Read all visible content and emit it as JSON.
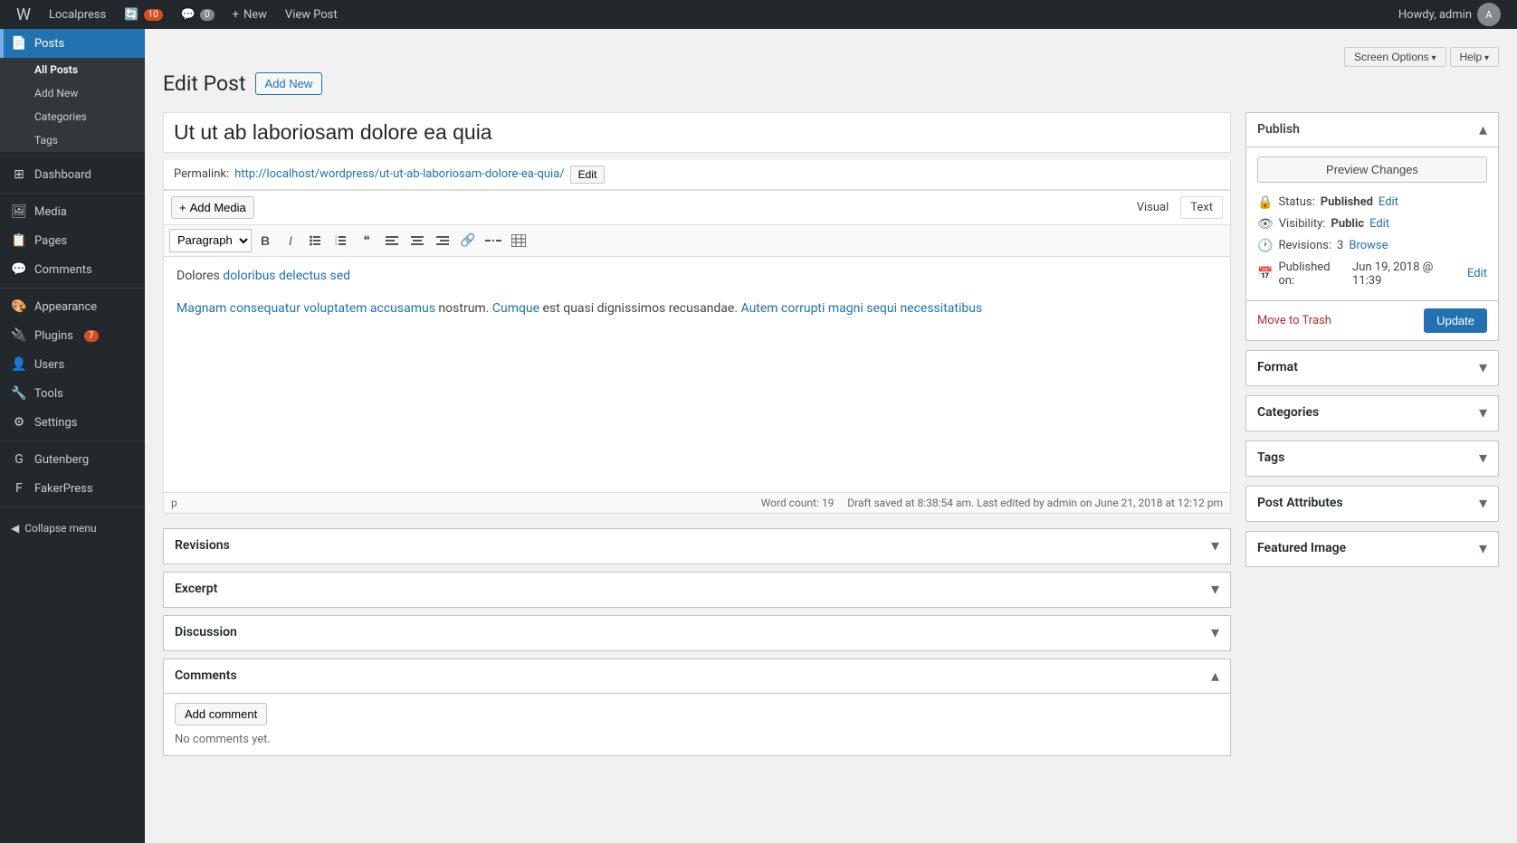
{
  "adminbar": {
    "site_name": "Localpress",
    "update_count": "10",
    "comment_count": "0",
    "new_label": "New",
    "view_post_label": "View Post",
    "howdy": "Howdy, admin",
    "screen_options_label": "Screen Options",
    "help_label": "Help"
  },
  "sidebar": {
    "items": [
      {
        "id": "dashboard",
        "label": "Dashboard",
        "icon": "⊞"
      },
      {
        "id": "posts",
        "label": "Posts",
        "icon": "📄",
        "active": true
      },
      {
        "id": "media",
        "label": "Media",
        "icon": "🖼"
      },
      {
        "id": "pages",
        "label": "Pages",
        "icon": "📋"
      },
      {
        "id": "comments",
        "label": "Comments",
        "icon": "💬"
      },
      {
        "id": "appearance",
        "label": "Appearance",
        "icon": "🎨"
      },
      {
        "id": "plugins",
        "label": "Plugins",
        "icon": "🔌",
        "badge": "7"
      },
      {
        "id": "users",
        "label": "Users",
        "icon": "👤"
      },
      {
        "id": "tools",
        "label": "Tools",
        "icon": "🔧"
      },
      {
        "id": "settings",
        "label": "Settings",
        "icon": "⚙"
      },
      {
        "id": "gutenberg",
        "label": "Gutenberg",
        "icon": "G"
      },
      {
        "id": "fakerpress",
        "label": "FakerPress",
        "icon": "F"
      }
    ],
    "posts_submenu": [
      {
        "id": "all-posts",
        "label": "All Posts",
        "active": true
      },
      {
        "id": "add-new",
        "label": "Add New"
      },
      {
        "id": "categories",
        "label": "Categories"
      },
      {
        "id": "tags",
        "label": "Tags"
      }
    ],
    "collapse_label": "Collapse menu"
  },
  "page": {
    "title": "Edit Post",
    "add_new_label": "Add New"
  },
  "post": {
    "title": "Ut ut ab laboriosam dolore ea quia",
    "permalink_label": "Permalink:",
    "permalink_url": "http://localhost/wordpress/ut-ut-ab-laboriosam-dolore-ea-quia/",
    "permalink_edit_label": "Edit",
    "content_p1": "Dolores doloribus delectus sed",
    "content_p2_part1": "Magnam consequatur voluptatem accusamus nostrum.",
    "content_p2_cumque": "Cumque",
    "content_p2_part2": " est quasi dignissimos recusandae.",
    "content_p2_part3": "Autem corrupti magni sequi necessitatibus",
    "word_count_label": "Word count:",
    "word_count": "19",
    "draft_saved": "Draft saved at 8:38:54 am. Last edited by admin on June 21, 2018 at 12:12 pm",
    "cursor_tag": "p"
  },
  "toolbar": {
    "add_media_label": "Add Media",
    "visual_tab": "Visual",
    "text_tab": "Text",
    "paragraph_select": "Paragraph",
    "buttons": [
      "B",
      "I",
      "≡",
      "≡",
      "❝",
      "◀",
      "▶",
      "▶",
      "🔗",
      "▦",
      "▦"
    ]
  },
  "publish_box": {
    "title": "Publish",
    "preview_changes_label": "Preview Changes",
    "status_label": "Status:",
    "status_value": "Published",
    "status_edit_label": "Edit",
    "visibility_label": "Visibility:",
    "visibility_value": "Public",
    "visibility_edit_label": "Edit",
    "revisions_label": "Revisions:",
    "revisions_count": "3",
    "revisions_browse_label": "Browse",
    "published_label": "Published on:",
    "published_date": "Jun 19, 2018 @ 11:39",
    "published_edit_label": "Edit",
    "move_to_trash_label": "Move to Trash",
    "update_label": "Update"
  },
  "metaboxes": {
    "format": {
      "title": "Format"
    },
    "categories": {
      "title": "Categories"
    },
    "tags": {
      "title": "Tags"
    },
    "post_attributes": {
      "title": "Post Attributes"
    },
    "featured_image": {
      "title": "Featured Image"
    },
    "revisions": {
      "title": "Revisions"
    },
    "excerpt": {
      "title": "Excerpt"
    },
    "discussion": {
      "title": "Discussion"
    },
    "comments": {
      "title": "Comments",
      "add_comment_label": "Add comment",
      "no_comments": "No comments yet."
    }
  }
}
